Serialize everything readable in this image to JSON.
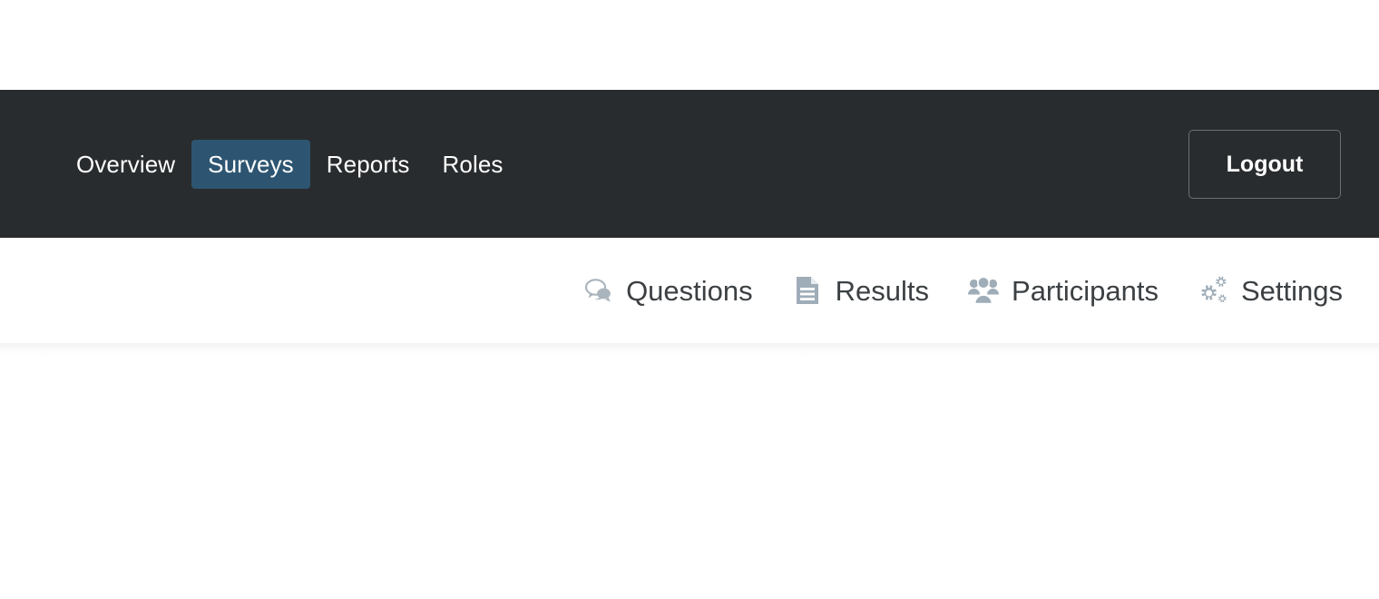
{
  "colors": {
    "navbar_bg": "#292c2e",
    "active_tab_bg": "#2d5571",
    "nav_text": "#ffffff",
    "subnav_text": "#3c4043",
    "subnav_icon": "#9aa7b0",
    "logout_border": "#6a7075",
    "page_bg": "#ffffff"
  },
  "navbar": {
    "links": [
      {
        "label": "Overview",
        "active": false,
        "name": "nav-link-overview"
      },
      {
        "label": "Surveys",
        "active": true,
        "name": "nav-link-surveys"
      },
      {
        "label": "Reports",
        "active": false,
        "name": "nav-link-reports"
      },
      {
        "label": "Roles",
        "active": false,
        "name": "nav-link-roles"
      }
    ],
    "logout_label": "Logout"
  },
  "subnav": {
    "items": [
      {
        "label": "Questions",
        "icon": "speech-bubbles-icon"
      },
      {
        "label": "Results",
        "icon": "document-icon"
      },
      {
        "label": "Participants",
        "icon": "people-group-icon"
      },
      {
        "label": "Settings",
        "icon": "gears-icon"
      }
    ]
  }
}
